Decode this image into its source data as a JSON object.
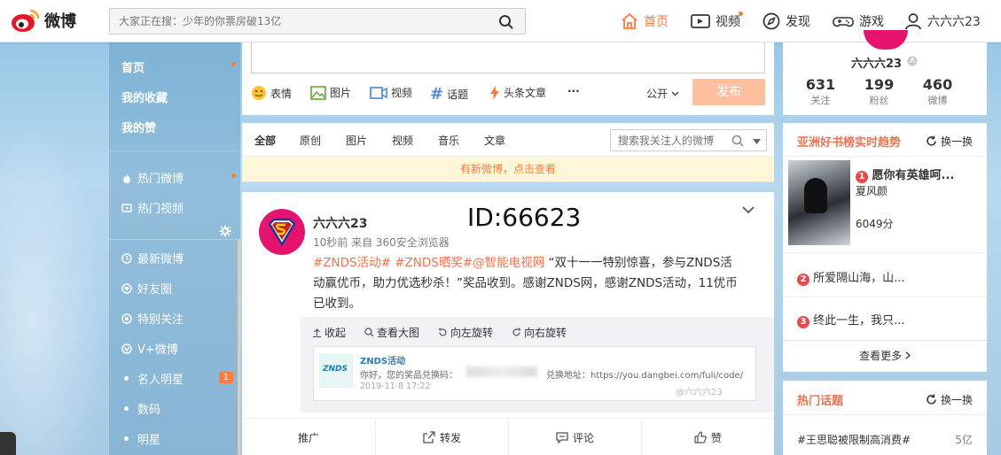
{
  "header": {
    "logo_text": "微博",
    "search_placeholder": "大家正在搜：少年的你票房破13亿",
    "nav": [
      {
        "label": "首页",
        "icon": "home-icon",
        "active": true
      },
      {
        "label": "视频",
        "icon": "video-icon"
      },
      {
        "label": "发现",
        "icon": "compass-icon"
      },
      {
        "label": "游戏",
        "icon": "gamepad-icon"
      },
      {
        "label": "六六六23",
        "icon": "user-icon"
      }
    ]
  },
  "sidebar": {
    "items": [
      {
        "label": "首页"
      },
      {
        "label": "我的收藏"
      },
      {
        "label": "我的赞"
      },
      {
        "label": "热门微博",
        "icon": "flame-icon"
      },
      {
        "label": "热门视频",
        "icon": "video-icon"
      },
      {
        "label": "最新微博",
        "icon": "clock-icon"
      },
      {
        "label": "好友圈",
        "icon": "heart-icon"
      },
      {
        "label": "特别关注",
        "icon": "target-icon"
      },
      {
        "label": "V+微博",
        "icon": "vplus-icon"
      },
      {
        "label": "名人明星",
        "badge": "1"
      },
      {
        "label": "数码"
      },
      {
        "label": "明星"
      }
    ]
  },
  "composer": {
    "tools": [
      "表情",
      "图片",
      "视频",
      "话题",
      "头条文章",
      "···"
    ],
    "visibility": "公开",
    "send_label": "发布"
  },
  "feed_tabs": {
    "tabs": [
      "全部",
      "原创",
      "图片",
      "视频",
      "音乐",
      "文章"
    ],
    "search_placeholder": "搜索我关注人的微博"
  },
  "new_notice": "有新微博，点击查看",
  "post": {
    "author": "六六六23",
    "id_overlay": "ID:66623",
    "meta": "10秒前 来自 360安全浏览器",
    "tags": "#ZNDS活动# #ZNDS晒奖#@智能电视网",
    "text": " “双十一一特别惊喜，参与ZNDS活动赢优币，助力优选秒杀！”奖品收到。感谢ZNDS网，感谢ZNDS活动，11优币已收到。",
    "media_tools": [
      "收起",
      "查看大图",
      "向左旋转",
      "向右旋转"
    ],
    "image": {
      "title": "ZNDS活动",
      "line1": "你好，您的奖品兑换码：",
      "line1b": "兑换地址：https://you.dangbei.com/fuli/code/",
      "date": "2019-11-8 17:22",
      "watermark": "@六六六23",
      "logo_text": "ZNDS"
    },
    "actions": [
      "推广",
      "转发",
      "评论",
      "赞"
    ]
  },
  "profile": {
    "name": "六六六23",
    "stats": [
      {
        "value": "631",
        "label": "关注"
      },
      {
        "value": "199",
        "label": "粉丝"
      },
      {
        "value": "460",
        "label": "微博"
      }
    ]
  },
  "trending_books": {
    "title": "亚洲好书榜实时趋势",
    "swap_label": "换一换",
    "items": [
      {
        "rank": "1",
        "title": "愿你有英雄呵...",
        "author": "夏风颜",
        "score": "6049分"
      },
      {
        "rank": "2",
        "title": "所爱隔山海，山..."
      },
      {
        "rank": "3",
        "title": "终此一生，我只..."
      }
    ],
    "more_label": "查看更多"
  },
  "hot_topics": {
    "title": "热门话题",
    "swap_label": "换一换",
    "items": [
      {
        "topic": "#王思聪被限制高消费#",
        "count": "5亿"
      }
    ]
  }
}
